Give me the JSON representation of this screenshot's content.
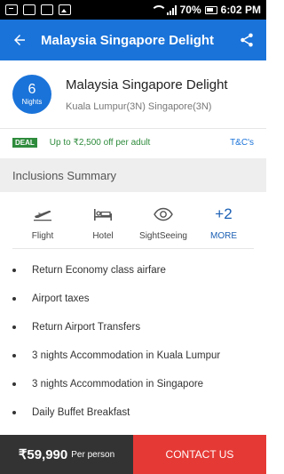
{
  "status_bar": {
    "battery": "70%",
    "time": "6:02 PM"
  },
  "app_bar": {
    "title": "Malaysia Singapore Delight",
    "background": "#1a73d9"
  },
  "package": {
    "nights_count": "6",
    "nights_label": "Nights",
    "name": "Malaysia Singapore Delight",
    "route": "Kuala Lumpur(3N) Singapore(3N)"
  },
  "deal": {
    "tag": "DEAL",
    "text": "Up to ₹2,500 off per adult",
    "tnc": "T&C's"
  },
  "inclusions": {
    "header": "Inclusions Summary",
    "icons": [
      {
        "label": "Flight",
        "icon": "flight-icon"
      },
      {
        "label": "Hotel",
        "icon": "hotel-icon"
      },
      {
        "label": "SightSeeing",
        "icon": "eye-icon"
      }
    ],
    "more": {
      "count": "+2",
      "label": "MORE"
    },
    "items": [
      "Return Economy class airfare",
      "Airport taxes",
      "Return Airport Transfers",
      "3 nights Accommodation in Kuala Lumpur",
      "3 nights Accommodation in Singapore",
      "Daily Buffet Breakfast"
    ]
  },
  "bottom_bar": {
    "price": "₹59,990",
    "price_unit": "Per person",
    "contact_label": "CONTACT US",
    "contact_color": "#e53935"
  }
}
